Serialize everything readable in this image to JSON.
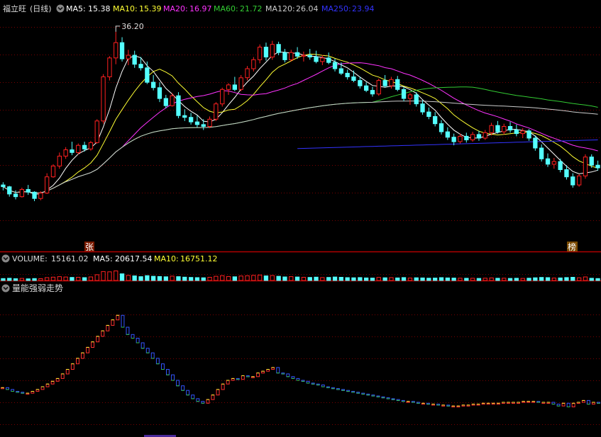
{
  "colors": {
    "background": "#000000",
    "grid": "#7a0000",
    "up": "#ff2020",
    "down": "#54ffff",
    "ma5": "#ffffff",
    "ma10": "#ffff33",
    "ma20": "#ff33ff",
    "ma60": "#33cc33",
    "ma120": "#cccccc",
    "ma250": "#3333ff",
    "text": "#dddddd"
  },
  "price_panel": {
    "stock_name": "福立旺",
    "period": "(日线)",
    "indicators": [
      {
        "label": "MA5:",
        "value": "15.38",
        "color": "#ffffff"
      },
      {
        "label": "MA10:",
        "value": "15.39",
        "color": "#ffff33"
      },
      {
        "label": "MA20:",
        "value": "16.97",
        "color": "#ff33ff"
      },
      {
        "label": "MA60:",
        "value": "21.72",
        "color": "#33cc33"
      },
      {
        "label": "MA120:",
        "value": "26.04",
        "color": "#cccccc"
      },
      {
        "label": "MA250:",
        "value": "23.94",
        "color": "#3333ff"
      }
    ],
    "high_marker": "36.20",
    "badge_left": "张",
    "badge_right": "榜"
  },
  "volume_panel": {
    "label": "VOLUME:",
    "value": "15161.02",
    "indicators": [
      {
        "label": "MA5:",
        "value": "20617.54",
        "color": "#ffffff"
      },
      {
        "label": "MA10:",
        "value": "16751.12",
        "color": "#ffff33"
      }
    ]
  },
  "indicator_panel": {
    "title": "量能强弱走势"
  },
  "chart_data": {
    "type": "candlestick",
    "ylim": [
      13,
      38
    ],
    "candles": [
      [
        19.2,
        19.5,
        18.6,
        19.0
      ],
      [
        19.0,
        19.1,
        17.9,
        18.2
      ],
      [
        18.2,
        18.6,
        17.6,
        17.9
      ],
      [
        17.9,
        18.9,
        17.8,
        18.7
      ],
      [
        18.7,
        19.2,
        18.1,
        18.4
      ],
      [
        18.4,
        18.5,
        17.4,
        17.7
      ],
      [
        17.7,
        18.5,
        17.5,
        18.3
      ],
      [
        18.3,
        20.5,
        18.2,
        20.1
      ],
      [
        20.1,
        21.5,
        20.0,
        21.3
      ],
      [
        21.3,
        22.8,
        21.0,
        22.4
      ],
      [
        22.4,
        23.4,
        22.1,
        23.1
      ],
      [
        23.1,
        24.0,
        22.5,
        22.8
      ],
      [
        22.8,
        23.8,
        22.6,
        23.6
      ],
      [
        23.6,
        24.0,
        22.9,
        23.2
      ],
      [
        23.2,
        24.1,
        23.0,
        23.9
      ],
      [
        23.9,
        26.5,
        23.8,
        26.3
      ],
      [
        26.3,
        31.5,
        26.0,
        31.2
      ],
      [
        31.2,
        33.5,
        30.8,
        33.3
      ],
      [
        33.3,
        36.2,
        32.6,
        35.0
      ],
      [
        35.0,
        35.6,
        32.9,
        33.2
      ],
      [
        33.2,
        34.2,
        32.5,
        33.6
      ],
      [
        33.6,
        34.1,
        32.2,
        32.6
      ],
      [
        32.6,
        33.4,
        31.9,
        32.2
      ],
      [
        32.2,
        32.9,
        30.4,
        30.6
      ],
      [
        30.6,
        31.4,
        29.7,
        30.0
      ],
      [
        30.0,
        30.6,
        28.4,
        28.8
      ],
      [
        28.8,
        29.2,
        27.7,
        28.0
      ],
      [
        28.0,
        29.4,
        27.9,
        29.1
      ],
      [
        29.1,
        29.5,
        26.6,
        26.9
      ],
      [
        26.9,
        27.6,
        26.3,
        26.7
      ],
      [
        26.7,
        27.2,
        25.9,
        26.2
      ],
      [
        26.2,
        26.9,
        25.6,
        25.9
      ],
      [
        25.9,
        26.5,
        25.3,
        25.7
      ],
      [
        25.7,
        26.8,
        25.5,
        26.5
      ],
      [
        26.5,
        28.4,
        26.3,
        28.2
      ],
      [
        28.2,
        30.0,
        27.9,
        29.8
      ],
      [
        29.8,
        30.5,
        29.2,
        30.3
      ],
      [
        30.3,
        31.2,
        29.6,
        29.8
      ],
      [
        29.8,
        31.4,
        29.6,
        31.1
      ],
      [
        31.1,
        32.4,
        30.8,
        32.1
      ],
      [
        32.1,
        33.4,
        31.8,
        33.1
      ],
      [
        33.1,
        34.8,
        32.7,
        34.5
      ],
      [
        34.5,
        35.0,
        33.0,
        33.4
      ],
      [
        33.4,
        35.2,
        33.1,
        34.8
      ],
      [
        34.8,
        35.1,
        33.6,
        33.9
      ],
      [
        33.9,
        34.3,
        32.8,
        33.1
      ],
      [
        33.1,
        34.2,
        32.9,
        33.9
      ],
      [
        33.9,
        34.5,
        33.2,
        33.5
      ],
      [
        33.5,
        34.0,
        32.9,
        33.6
      ],
      [
        33.6,
        34.3,
        33.1,
        33.4
      ],
      [
        33.4,
        34.1,
        32.7,
        32.9
      ],
      [
        32.9,
        33.6,
        32.5,
        33.3
      ],
      [
        33.3,
        33.9,
        32.6,
        32.8
      ],
      [
        32.8,
        33.2,
        31.8,
        32.1
      ],
      [
        32.1,
        32.8,
        31.4,
        31.6
      ],
      [
        31.6,
        32.0,
        30.9,
        31.2
      ],
      [
        31.2,
        31.9,
        30.6,
        30.8
      ],
      [
        30.8,
        31.2,
        29.9,
        30.2
      ],
      [
        30.2,
        30.6,
        29.5,
        29.7
      ],
      [
        29.7,
        30.1,
        29.0,
        29.3
      ],
      [
        29.3,
        31.0,
        29.1,
        30.8
      ],
      [
        30.8,
        31.4,
        30.0,
        30.2
      ],
      [
        30.2,
        31.2,
        29.9,
        30.9
      ],
      [
        30.9,
        31.3,
        29.6,
        29.8
      ],
      [
        29.8,
        30.1,
        28.5,
        28.8
      ],
      [
        28.8,
        29.4,
        28.1,
        29.2
      ],
      [
        29.2,
        29.5,
        27.9,
        28.2
      ],
      [
        28.2,
        28.6,
        27.0,
        27.3
      ],
      [
        27.3,
        27.8,
        26.5,
        26.8
      ],
      [
        26.8,
        27.3,
        25.7,
        26.0
      ],
      [
        26.0,
        26.4,
        24.8,
        25.1
      ],
      [
        25.1,
        25.6,
        24.2,
        24.5
      ],
      [
        24.5,
        24.9,
        23.6,
        24.0
      ],
      [
        24.0,
        24.9,
        23.8,
        24.6
      ],
      [
        24.6,
        25.0,
        23.9,
        24.2
      ],
      [
        24.2,
        25.1,
        24.0,
        24.8
      ],
      [
        24.8,
        25.2,
        24.1,
        24.4
      ],
      [
        24.4,
        25.3,
        24.2,
        25.0
      ],
      [
        25.0,
        26.1,
        24.7,
        25.8
      ],
      [
        25.8,
        26.3,
        24.9,
        25.1
      ],
      [
        25.1,
        26.0,
        24.8,
        25.7
      ],
      [
        25.7,
        26.2,
        25.0,
        25.3
      ],
      [
        25.3,
        25.9,
        24.6,
        24.9
      ],
      [
        24.9,
        25.5,
        24.4,
        25.2
      ],
      [
        25.2,
        25.4,
        24.1,
        24.4
      ],
      [
        24.4,
        24.7,
        23.0,
        23.3
      ],
      [
        23.3,
        23.7,
        21.8,
        22.1
      ],
      [
        22.1,
        22.7,
        21.2,
        21.5
      ],
      [
        21.5,
        22.2,
        21.0,
        21.8
      ],
      [
        21.8,
        22.1,
        20.6,
        20.9
      ],
      [
        20.9,
        21.4,
        19.8,
        20.1
      ],
      [
        20.1,
        20.5,
        18.9,
        19.2
      ],
      [
        19.2,
        20.4,
        19.0,
        20.2
      ],
      [
        20.2,
        22.6,
        19.9,
        22.3
      ],
      [
        22.3,
        22.6,
        21.1,
        21.4
      ],
      [
        21.4,
        21.9,
        20.8,
        21.1
      ]
    ],
    "volume_max": 100000,
    "volumes": [
      15000,
      17000,
      14000,
      16000,
      13000,
      15000,
      14000,
      22000,
      26000,
      30000,
      27000,
      24000,
      25000,
      22000,
      28000,
      45000,
      70000,
      68000,
      75000,
      52000,
      40000,
      36000,
      30000,
      38000,
      33000,
      31000,
      29000,
      34000,
      30000,
      26000,
      24000,
      22000,
      21000,
      25000,
      33000,
      38000,
      31000,
      29000,
      35000,
      37000,
      40000,
      43000,
      36000,
      39000,
      33000,
      28000,
      30000,
      27000,
      25000,
      24000,
      26000,
      23000,
      24000,
      27000,
      25000,
      22000,
      21000,
      23000,
      20000,
      19000,
      24000,
      21000,
      22000,
      20000,
      23000,
      19000,
      21000,
      20000,
      18000,
      19000,
      22000,
      20000,
      19000,
      18000,
      17000,
      17000,
      16000,
      18000,
      20000,
      17000,
      18000,
      16000,
      17000,
      16000,
      18000,
      21000,
      24000,
      22000,
      19000,
      20000,
      23000,
      25000,
      21000,
      28000,
      17000,
      15161
    ],
    "strength": {
      "ylim": [
        -6,
        9
      ],
      "values": [
        -1.0,
        -1.2,
        -1.4,
        -1.5,
        -1.6,
        -1.6,
        -1.4,
        -1.2,
        -0.9,
        -0.6,
        -0.3,
        0.0,
        0.5,
        1.0,
        1.6,
        2.2,
        2.8,
        3.4,
        4.0,
        4.6,
        5.2,
        5.8,
        6.4,
        6.9,
        5.6,
        4.8,
        4.4,
        3.9,
        3.3,
        2.8,
        2.2,
        1.6,
        1.0,
        0.4,
        -0.2,
        -0.8,
        -1.3,
        -1.8,
        -2.2,
        -2.5,
        -2.7,
        -2.3,
        -1.8,
        -1.2,
        -0.6,
        -0.2,
        0.0,
        -0.1,
        0.3,
        0.2,
        0.2,
        0.6,
        0.8,
        1.0,
        1.2,
        0.6,
        0.5,
        0.2,
        0.0,
        -0.2,
        -0.3,
        -0.5,
        -0.6,
        -0.7,
        -0.9,
        -1.0,
        -1.1,
        -1.2,
        -1.3,
        -1.4,
        -1.5,
        -1.6,
        -1.7,
        -1.8,
        -1.9,
        -2.0,
        -2.1,
        -2.2,
        -2.3,
        -2.4,
        -2.5,
        -2.5,
        -2.6,
        -2.7,
        -2.7,
        -2.8,
        -2.8,
        -2.9,
        -2.9,
        -3.0,
        -3.0,
        -3.0,
        -2.9,
        -2.9,
        -2.8,
        -2.8,
        -2.7,
        -2.7,
        -2.7,
        -2.7,
        -2.6,
        -2.6,
        -2.6,
        -2.6,
        -2.5,
        -2.5,
        -2.5,
        -2.6,
        -2.6,
        -2.6,
        -2.8,
        -3.0,
        -2.7,
        -3.1,
        -2.7,
        -2.6,
        -2.4,
        -2.8,
        -2.6,
        -2.7
      ]
    }
  }
}
